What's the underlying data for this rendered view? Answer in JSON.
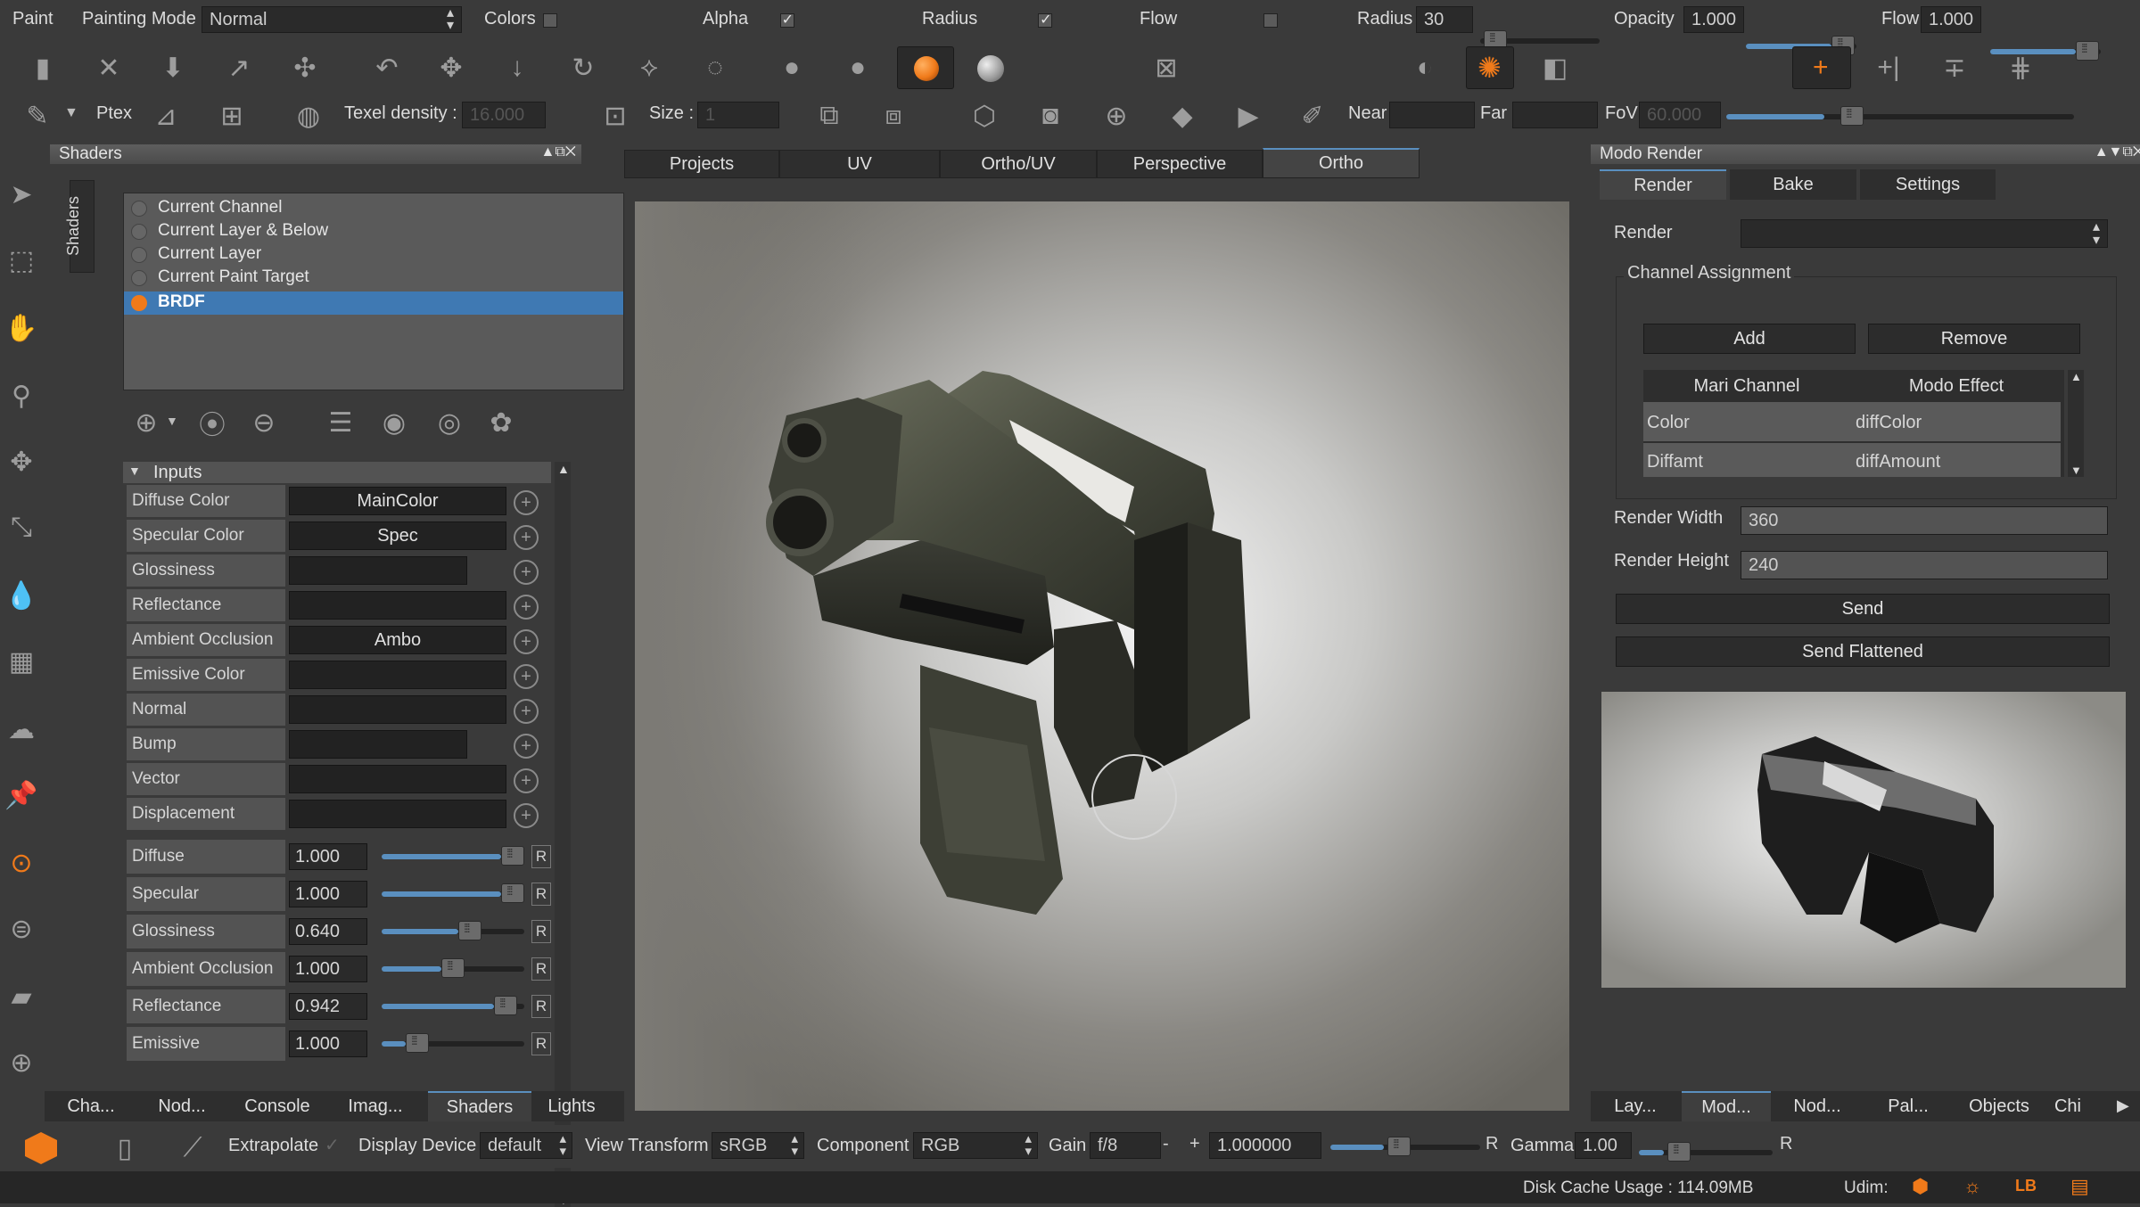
{
  "colors": {
    "accent": "#f07a1a",
    "selection": "#3f79b3",
    "slider_fill": "#5a8fbf"
  },
  "top": {
    "paint": "Paint",
    "painting_mode_label": "Painting Mode",
    "painting_mode_value": "Normal",
    "colors_label": "Colors",
    "alpha_label": "Alpha",
    "radius_toggle_label": "Radius",
    "flow_toggle_label": "Flow",
    "radius_label": "Radius",
    "radius_value": "30",
    "opacity_label": "Opacity",
    "opacity_value": "1.000",
    "flow_label": "Flow",
    "flow_value": "1.000"
  },
  "toolbar2": {
    "ptex": "Ptex",
    "texel_density": "Texel density :",
    "texel_value": "16.000",
    "size": "Size :",
    "size_value": "1",
    "near": "Near",
    "far": "Far",
    "fov": "FoV",
    "fov_value": "60.000"
  },
  "shaders_panel": {
    "title": "Shaders",
    "side_tab": "Shaders",
    "list": [
      "Current Channel",
      "Current Layer & Below",
      "Current Layer",
      "Current Paint Target",
      "BRDF"
    ],
    "inputs_header": "Inputs",
    "inputs": [
      {
        "name": "Diffuse Color",
        "value": "MainColor"
      },
      {
        "name": "Specular Color",
        "value": "Spec"
      },
      {
        "name": "Glossiness",
        "value": ""
      },
      {
        "name": "Reflectance",
        "value": ""
      },
      {
        "name": "Ambient Occlusion",
        "value": "Ambo"
      },
      {
        "name": "Emissive Color",
        "value": ""
      },
      {
        "name": "Normal",
        "value": ""
      },
      {
        "name": "Bump",
        "value": ""
      },
      {
        "name": "Vector",
        "value": ""
      },
      {
        "name": "Displacement",
        "value": ""
      }
    ],
    "sliders": [
      {
        "name": "Diffuse",
        "value": "1.000",
        "level": 1.0
      },
      {
        "name": "Specular",
        "value": "1.000",
        "level": 1.0
      },
      {
        "name": "Glossiness",
        "value": "0.640",
        "level": 0.64
      },
      {
        "name": "Ambient Occlusion",
        "value": "1.000",
        "level": 0.5
      },
      {
        "name": "Reflectance",
        "value": "0.942",
        "level": 0.94
      },
      {
        "name": "Emissive",
        "value": "1.000",
        "level": 0.2
      }
    ],
    "r_label": "R",
    "bottom_tabs": [
      "Cha...",
      "Nod...",
      "Console",
      "Imag...",
      "Shaders",
      "Lights"
    ]
  },
  "viewport": {
    "tabs": [
      "Projects",
      "UV",
      "Ortho/UV",
      "Perspective",
      "Ortho"
    ]
  },
  "render_panel": {
    "title": "Modo Render",
    "tabs": [
      "Render",
      "Bake",
      "Settings"
    ],
    "render_label": "Render",
    "channel_assignment": "Channel Assignment",
    "add": "Add",
    "remove": "Remove",
    "col_mari": "Mari Channel",
    "col_modo": "Modo Effect",
    "rows": [
      {
        "mari": "Color",
        "modo": "diffColor"
      },
      {
        "mari": "Diffamt",
        "modo": "diffAmount"
      }
    ],
    "render_width_label": "Render Width",
    "render_width": "360",
    "render_height_label": "Render Height",
    "render_height": "240",
    "send": "Send",
    "send_flattened": "Send Flattened",
    "bottom_tabs": [
      "Lay...",
      "Mod...",
      "Nod...",
      "Pal...",
      "Objects",
      "Chi"
    ]
  },
  "statusbar": {
    "extrapolate": "Extrapolate",
    "display_device_label": "Display Device",
    "display_device": "default",
    "view_transform_label": "View Transform",
    "view_transform": "sRGB",
    "component_label": "Component",
    "component": "RGB",
    "gain_label": "Gain",
    "gain_stop": "f/8",
    "gain_value": "1.000000",
    "r": "R",
    "gamma_label": "Gamma",
    "gamma_value": "1.00",
    "disk_cache": "Disk Cache Usage : 114.09MB",
    "udim": "Udim:"
  }
}
